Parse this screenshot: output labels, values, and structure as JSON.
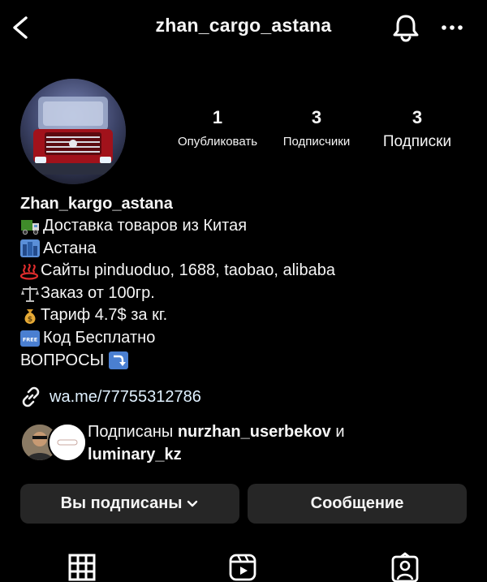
{
  "header": {
    "username": "zhan_cargo_astana",
    "back_icon": "chevron-left-icon",
    "notify_icon": "bell-icon",
    "more_icon": "more-horizontal-icon"
  },
  "profile": {
    "stats": [
      {
        "count": "1",
        "label": "Опубликовать"
      },
      {
        "count": "3",
        "label": "Подписчики"
      },
      {
        "count": "3",
        "label": "Подписки"
      }
    ]
  },
  "bio": {
    "name": "Zhan_kargo_astana",
    "lines": [
      {
        "icon": "truck-emoji",
        "text": "Доставка товаров из Китая"
      },
      {
        "icon": "city-emoji",
        "text": "Астана"
      },
      {
        "icon": "hot-springs-emoji",
        "text": "Сайты pinduoduo, 1688, taobao, alibaba"
      },
      {
        "icon": "balance-scale-emoji",
        "text": "Заказ от 100гр."
      },
      {
        "icon": "money-bag-emoji",
        "text": "Тариф 4.7$ за кг."
      },
      {
        "icon": "free-button-emoji",
        "text": "Код Бесплатно"
      },
      {
        "icon": "arrow-curving-down-emoji",
        "text": "ВОПРОСЫ"
      }
    ]
  },
  "link": {
    "icon": "link-icon",
    "url": "wa.me/77755312786"
  },
  "followed_by": {
    "prefix": "Подписаны",
    "user1": "nurzhan_userbekov",
    "and": "и",
    "user2": "luminary_kz"
  },
  "actions": {
    "following_label": "Вы подписаны",
    "message_label": "Сообщение"
  },
  "tabs": [
    "grid-icon",
    "reels-icon",
    "tagged-icon"
  ]
}
